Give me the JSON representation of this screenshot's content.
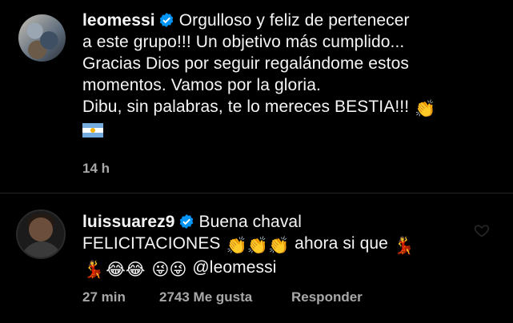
{
  "caption": {
    "username": "leomessi",
    "lines": [
      "Orgulloso y feliz de pertenecer",
      "a este grupo!!! Un objetivo más cumplido...",
      "Gracias Dios por seguir regalándome estos",
      "momentos. Vamos por la gloria.",
      "Dibu, sin palabras, te lo mereces BESTIA!!!"
    ],
    "timestamp": "14 h"
  },
  "comment": {
    "username": "luissuarez9",
    "line1": "Buena chaval",
    "line2_text": "FELICITACIONES",
    "line2_after": "ahora si que",
    "mention": "@leomessi",
    "timestamp": "27 min",
    "likes": "2743 Me gusta",
    "reply_label": "Responder"
  },
  "colors": {
    "background": "#000000",
    "text": "#f5f5f5",
    "meta": "#a8a8a8",
    "verified": "#0095f6"
  },
  "icons": [
    "verified-badge-icon",
    "clapping-hands-emoji",
    "argentina-flag-emoji",
    "dancing-woman-emoji",
    "laughing-face-emoji",
    "winking-tongue-face-emoji",
    "heart-icon"
  ]
}
